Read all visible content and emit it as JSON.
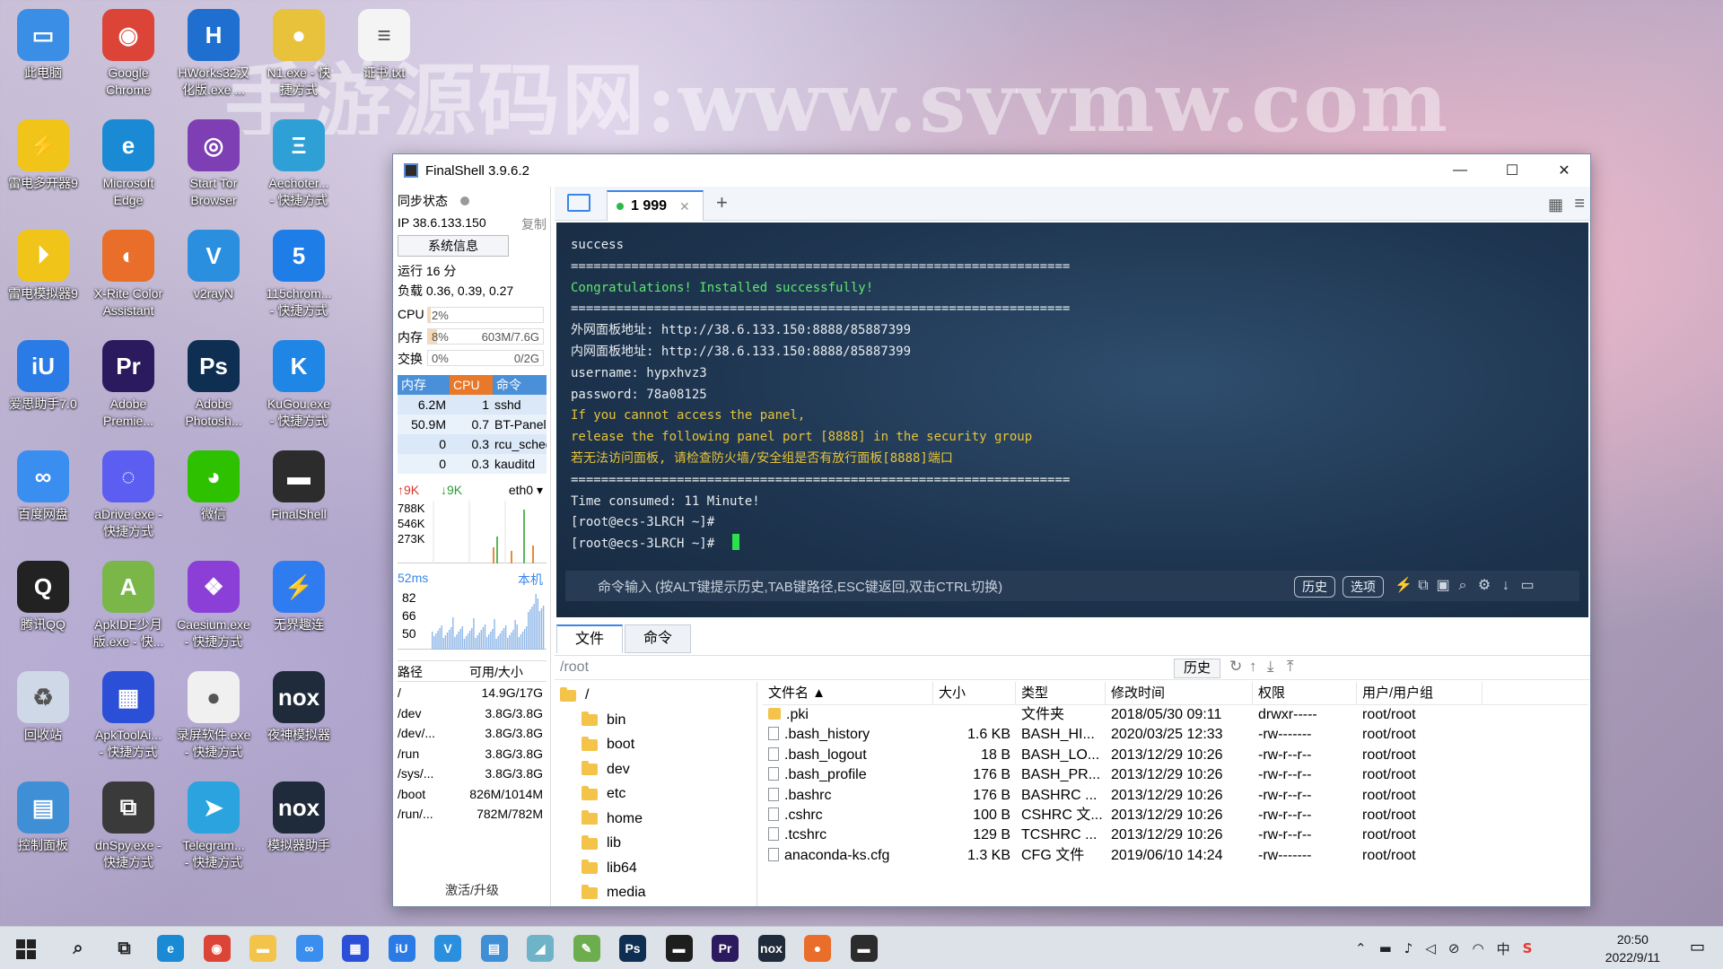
{
  "watermark": "手游源码网:www.syymw.com",
  "desktop": {
    "icons": [
      {
        "label": "此电脑",
        "color": "#3a8ee6",
        "glyph": "▭",
        "col": 0,
        "row": 0
      },
      {
        "label": "Google\nChrome",
        "color": "#db4437",
        "glyph": "◉",
        "col": 1,
        "row": 0
      },
      {
        "label": "HWorks32汉\n化版.exe ...",
        "color": "#1f6fd1",
        "glyph": "H",
        "col": 2,
        "row": 0
      },
      {
        "label": "N1.exe - 快\n捷方式",
        "color": "#e8c23a",
        "glyph": "●",
        "col": 3,
        "row": 0
      },
      {
        "label": "证书.txt",
        "color": "#f4f4f4",
        "glyph": "≡",
        "col": 4,
        "row": 0
      },
      {
        "label": "雷电多开器9",
        "color": "#f0c419",
        "glyph": "⚡",
        "col": 0,
        "row": 1
      },
      {
        "label": "Microsoft\nEdge",
        "color": "#1a8ad4",
        "glyph": "e",
        "col": 1,
        "row": 1
      },
      {
        "label": "Start Tor\nBrowser",
        "color": "#7d3fb3",
        "glyph": "◎",
        "col": 2,
        "row": 1
      },
      {
        "label": "Aechoter...\n- 快捷方式",
        "color": "#2fa0d6",
        "glyph": "Ξ",
        "col": 3,
        "row": 1
      },
      {
        "label": "雷电模拟器9",
        "color": "#f0c419",
        "glyph": "⏵",
        "col": 0,
        "row": 2
      },
      {
        "label": "X-Rite Color\nAssistant",
        "color": "#e86e2a",
        "glyph": "◐",
        "col": 1,
        "row": 2
      },
      {
        "label": "v2rayN",
        "color": "#2b8fe0",
        "glyph": "V",
        "col": 2,
        "row": 2
      },
      {
        "label": "115chrom...\n- 快捷方式",
        "color": "#1f7de8",
        "glyph": "5",
        "col": 3,
        "row": 2
      },
      {
        "label": "爱思助手7.0",
        "color": "#2a7be6",
        "glyph": "iU",
        "col": 0,
        "row": 3
      },
      {
        "label": "Adobe\nPremie...",
        "color": "#2b1a5e",
        "glyph": "Pr",
        "col": 1,
        "row": 3
      },
      {
        "label": "Adobe\nPhotosh...",
        "color": "#0e2f52",
        "glyph": "Ps",
        "col": 2,
        "row": 3
      },
      {
        "label": "KuGou.exe\n- 快捷方式",
        "color": "#1f86e6",
        "glyph": "K",
        "col": 3,
        "row": 3
      },
      {
        "label": "百度网盘",
        "color": "#3a8ef0",
        "glyph": "∞",
        "col": 0,
        "row": 4
      },
      {
        "label": "aDrive.exe -\n快捷方式",
        "color": "#5b5ef0",
        "glyph": "◌",
        "col": 1,
        "row": 4
      },
      {
        "label": "微信",
        "color": "#2dc100",
        "glyph": "◕",
        "col": 2,
        "row": 4
      },
      {
        "label": "FinalShell",
        "color": "#2c2c2c",
        "glyph": "▬",
        "col": 3,
        "row": 4
      },
      {
        "label": "腾讯QQ",
        "color": "#222222",
        "glyph": "Q",
        "col": 0,
        "row": 5
      },
      {
        "label": "ApkIDE少月\n版.exe - 快...",
        "color": "#7ab648",
        "glyph": "A",
        "col": 1,
        "row": 5
      },
      {
        "label": "Caesium.exe\n- 快捷方式",
        "color": "#8b3fd6",
        "glyph": "❖",
        "col": 2,
        "row": 5
      },
      {
        "label": "无界趣连",
        "color": "#2f7cf0",
        "glyph": "⚡",
        "col": 3,
        "row": 5
      },
      {
        "label": "回收站",
        "color": "#cfd8e6",
        "glyph": "♻",
        "col": 0,
        "row": 6
      },
      {
        "label": "ApkToolAi...\n- 快捷方式",
        "color": "#2b4fd6",
        "glyph": "▦",
        "col": 1,
        "row": 6
      },
      {
        "label": "录屏软件.exe\n- 快捷方式",
        "color": "#f0f0f0",
        "glyph": "●",
        "col": 2,
        "row": 6
      },
      {
        "label": "夜神模拟器",
        "color": "#1f2a3a",
        "glyph": "nox",
        "col": 3,
        "row": 6
      },
      {
        "label": "控制面板",
        "color": "#3f8fd6",
        "glyph": "▤",
        "col": 0,
        "row": 7
      },
      {
        "label": "dnSpy.exe -\n快捷方式",
        "color": "#3a3a3a",
        "glyph": "⧉",
        "col": 1,
        "row": 7
      },
      {
        "label": "Telegram...\n- 快捷方式",
        "color": "#2aa3df",
        "glyph": "➤",
        "col": 2,
        "row": 7
      },
      {
        "label": "模拟器助手",
        "color": "#1f2a3a",
        "glyph": "nox",
        "col": 3,
        "row": 7
      }
    ]
  },
  "window": {
    "title": "FinalShell 3.9.6.2",
    "controls": {
      "minimize": "—",
      "maximize": "☐",
      "close": "✕"
    }
  },
  "leftpanel": {
    "sync_label": "同步状态",
    "ip": "IP 38.6.133.150",
    "copy": "复制",
    "sysinfo_button": "系统信息",
    "uptime": "运行 16 分",
    "load": "负载 0.36, 0.39, 0.27",
    "cpu": {
      "label": "CPU",
      "pct": "2%",
      "fill": 2
    },
    "mem": {
      "label": "内存",
      "pct": "8%",
      "value": "603M/7.6G",
      "fill": 8
    },
    "swap": {
      "label": "交换",
      "pct": "0%",
      "value": "0/2G",
      "fill": 0
    },
    "proc_headers": {
      "mem": "内存",
      "cpu": "CPU",
      "cmd": "命令"
    },
    "processes": [
      {
        "mem": "6.2M",
        "cpu": "1",
        "cmd": "sshd"
      },
      {
        "mem": "50.9M",
        "cpu": "0.7",
        "cmd": "BT-Panel"
      },
      {
        "mem": "0",
        "cpu": "0.3",
        "cmd": "rcu_sched"
      },
      {
        "mem": "0",
        "cpu": "0.3",
        "cmd": "kauditd"
      }
    ],
    "net": {
      "up": "↑9K",
      "down": "↓9K",
      "iface": "eth0 ▾",
      "ticks": [
        "788K",
        "546K",
        "273K"
      ]
    },
    "ping": {
      "latency": "52ms",
      "host": "本机",
      "ticks": [
        "82",
        "66",
        "50"
      ]
    },
    "fs_headers": {
      "path": "路径",
      "size": "可用/大小"
    },
    "filesystems": [
      {
        "path": "/",
        "size": "14.9G/17G"
      },
      {
        "path": "/dev",
        "size": "3.8G/3.8G"
      },
      {
        "path": "/dev/...",
        "size": "3.8G/3.8G"
      },
      {
        "path": "/run",
        "size": "3.8G/3.8G"
      },
      {
        "path": "/sys/...",
        "size": "3.8G/3.8G"
      },
      {
        "path": "/boot",
        "size": "826M/1014M"
      },
      {
        "path": "/run/...",
        "size": "782M/782M"
      }
    ],
    "activate": "激活/升级"
  },
  "tabs": {
    "session": "1 999",
    "add": "+"
  },
  "terminal": {
    "lines": [
      {
        "text": "success",
        "color": "white"
      },
      {
        "text": "==================================================================",
        "color": "white"
      },
      {
        "text": "Congratulations! Installed successfully!",
        "color": "green"
      },
      {
        "text": "==================================================================",
        "color": "white"
      },
      {
        "text": "外网面板地址: http://38.6.133.150:8888/85887399",
        "color": "white"
      },
      {
        "text": "内网面板地址: http://38.6.133.150:8888/85887399",
        "color": "white"
      },
      {
        "text": "username: hypxhvz3",
        "color": "white"
      },
      {
        "text": "password: 78a08125",
        "color": "white"
      },
      {
        "text": "If you cannot access the panel,",
        "color": "yellow"
      },
      {
        "text": "release the following panel port [8888] in the security group",
        "color": "yellow"
      },
      {
        "text": "若无法访问面板, 请检查防火墙/安全组是否有放行面板[8888]端口",
        "color": "yellow"
      },
      {
        "text": "==================================================================",
        "color": "white"
      },
      {
        "text": "Time consumed: 11 Minute!",
        "color": "white"
      },
      {
        "text": "[root@ecs-3LRCH ~]#",
        "color": "white"
      },
      {
        "text": "[root@ecs-3LRCH ~]# ",
        "color": "white"
      }
    ],
    "cmd_placeholder": "命令输入 (按ALT键提示历史,TAB键路径,ESC键返回,双击CTRL切换)",
    "history_button": "历史",
    "options_button": "选项"
  },
  "lower": {
    "tab_files": "文件",
    "tab_commands": "命令",
    "path": "/root",
    "history": "历史",
    "tree": [
      {
        "name": "/",
        "level": 0
      },
      {
        "name": "bin",
        "level": 1
      },
      {
        "name": "boot",
        "level": 1
      },
      {
        "name": "dev",
        "level": 1
      },
      {
        "name": "etc",
        "level": 1
      },
      {
        "name": "home",
        "level": 1
      },
      {
        "name": "lib",
        "level": 1
      },
      {
        "name": "lib64",
        "level": 1
      },
      {
        "name": "media",
        "level": 1
      }
    ],
    "columns": {
      "name": "文件名 ▲",
      "size": "大小",
      "type": "类型",
      "modified": "修改时间",
      "perm": "权限",
      "owner": "用户/用户组"
    },
    "files": [
      {
        "name": ".pki",
        "size": "",
        "type": "文件夹",
        "modified": "2018/05/30 09:11",
        "perm": "drwxr-----",
        "owner": "root/root",
        "folder": true
      },
      {
        "name": ".bash_history",
        "size": "1.6 KB",
        "type": "BASH_HI...",
        "modified": "2020/03/25 12:33",
        "perm": "-rw-------",
        "owner": "root/root",
        "folder": false
      },
      {
        "name": ".bash_logout",
        "size": "18 B",
        "type": "BASH_LO...",
        "modified": "2013/12/29 10:26",
        "perm": "-rw-r--r--",
        "owner": "root/root",
        "folder": false
      },
      {
        "name": ".bash_profile",
        "size": "176 B",
        "type": "BASH_PR...",
        "modified": "2013/12/29 10:26",
        "perm": "-rw-r--r--",
        "owner": "root/root",
        "folder": false
      },
      {
        "name": ".bashrc",
        "size": "176 B",
        "type": "BASHRC ...",
        "modified": "2013/12/29 10:26",
        "perm": "-rw-r--r--",
        "owner": "root/root",
        "folder": false
      },
      {
        "name": ".cshrc",
        "size": "100 B",
        "type": "CSHRC 文...",
        "modified": "2013/12/29 10:26",
        "perm": "-rw-r--r--",
        "owner": "root/root",
        "folder": false
      },
      {
        "name": ".tcshrc",
        "size": "129 B",
        "type": "TCSHRC ...",
        "modified": "2013/12/29 10:26",
        "perm": "-rw-r--r--",
        "owner": "root/root",
        "folder": false
      },
      {
        "name": "anaconda-ks.cfg",
        "size": "1.3 KB",
        "type": "CFG 文件",
        "modified": "2019/06/10 14:24",
        "perm": "-rw-------",
        "owner": "root/root",
        "folder": false
      }
    ]
  },
  "taskbar": {
    "apps": [
      {
        "name": "search-icon",
        "glyph": "⌕",
        "color": "transparent"
      },
      {
        "name": "task-view-icon",
        "glyph": "⧉",
        "color": "transparent"
      },
      {
        "name": "edge-icon",
        "glyph": "e",
        "color": "#1a8ad4"
      },
      {
        "name": "chrome-icon",
        "glyph": "◉",
        "color": "#db4437"
      },
      {
        "name": "explorer-icon",
        "glyph": "▬",
        "color": "#f3c34a"
      },
      {
        "name": "baidu-netdisk-icon",
        "glyph": "∞",
        "color": "#3a8ef0"
      },
      {
        "name": "apktool-icon",
        "glyph": "▦",
        "color": "#2b4fd6"
      },
      {
        "name": "i4-icon",
        "glyph": "iU",
        "color": "#2a7be6"
      },
      {
        "name": "v2rayn-icon",
        "glyph": "V",
        "color": "#2b8fe0"
      },
      {
        "name": "control-panel-icon",
        "glyph": "▤",
        "color": "#3f8fd6"
      },
      {
        "name": "tool-icon",
        "glyph": "◢",
        "color": "#6fb3c9"
      },
      {
        "name": "notepad-icon",
        "glyph": "✎",
        "color": "#6cae4e"
      },
      {
        "name": "photoshop-icon",
        "glyph": "Ps",
        "color": "#0e2f52"
      },
      {
        "name": "terminal-icon",
        "glyph": "▬",
        "color": "#1e1e1e"
      },
      {
        "name": "premiere-icon",
        "glyph": "Pr",
        "color": "#2b1a5e"
      },
      {
        "name": "nox-icon",
        "glyph": "nox",
        "color": "#1f2a3a"
      },
      {
        "name": "recorder-icon",
        "glyph": "●",
        "color": "#e86e2a"
      },
      {
        "name": "finalshell-taskbar-icon",
        "glyph": "▬",
        "color": "#2c2c2c"
      }
    ],
    "tray_ime": "中",
    "time": "20:50",
    "date": "2022/9/11"
  },
  "colors": {
    "accent": "#3a86e8",
    "terminal_bg": "#1e3550",
    "proc_head_mem": "#4a90d9",
    "proc_head_cpu": "#e8782a",
    "proc_head_cmd": "#4a90d9"
  }
}
